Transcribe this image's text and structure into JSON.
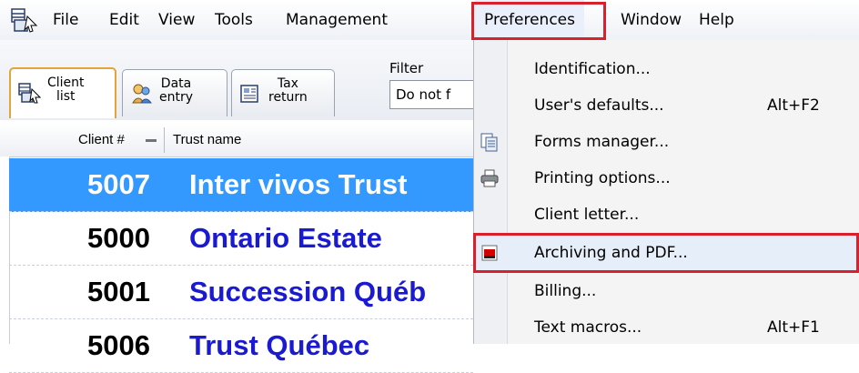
{
  "menubar": {
    "items": [
      {
        "label": "File"
      },
      {
        "label": "Edit"
      },
      {
        "label": "View"
      },
      {
        "label": "Tools"
      },
      {
        "label": "Management"
      },
      {
        "label": "Preferences"
      },
      {
        "label": "Window"
      },
      {
        "label": "Help"
      }
    ]
  },
  "toolbar": {
    "tabs": [
      {
        "label": "Client\nlist"
      },
      {
        "label": "Data\nentry"
      },
      {
        "label": "Tax\nreturn"
      }
    ],
    "filter_label": "Filter",
    "filter_value": "Do not f"
  },
  "table": {
    "columns": [
      "Client #",
      "Trust name"
    ],
    "rows": [
      {
        "num": "5007",
        "name": "Inter vivos Trust"
      },
      {
        "num": "5000",
        "name": "Ontario Estate"
      },
      {
        "num": "5001",
        "name": "Succession Québ"
      },
      {
        "num": "5006",
        "name": "Trust Québec"
      }
    ]
  },
  "preferences_menu": {
    "items": [
      {
        "label": "Identification...",
        "shortcut": ""
      },
      {
        "label": "User's defaults...",
        "shortcut": "Alt+F2"
      },
      {
        "label": "Forms manager...",
        "shortcut": "",
        "icon": "forms-icon"
      },
      {
        "label": "Printing options...",
        "shortcut": "",
        "icon": "printer-icon"
      },
      {
        "label": "Client letter...",
        "shortcut": ""
      },
      {
        "label": "Archiving and PDF...",
        "shortcut": "",
        "icon": "pdf-icon"
      },
      {
        "label": "Billing...",
        "shortcut": ""
      },
      {
        "label": "Text macros...",
        "shortcut": "Alt+F1"
      }
    ]
  },
  "colors": {
    "selection": "#3399ff",
    "name_text": "#1a1ad1",
    "highlight_box": "#d9202d"
  }
}
